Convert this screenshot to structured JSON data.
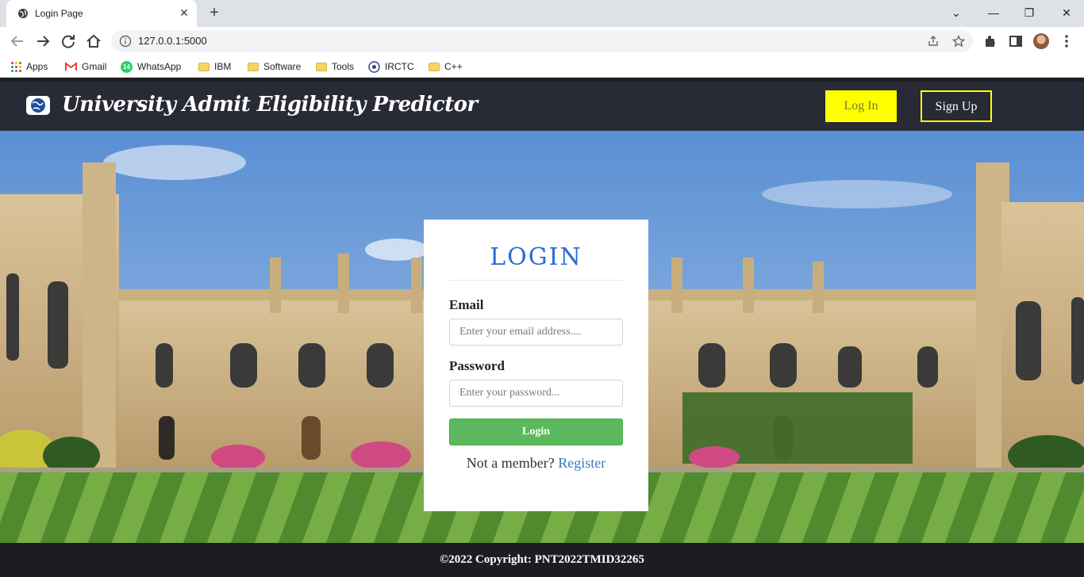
{
  "browser": {
    "tab_title": "Login Page",
    "url": "127.0.0.1:5000",
    "bookmarks": [
      {
        "label": "Apps",
        "icon": "apps-grid-icon"
      },
      {
        "label": "Gmail",
        "icon": "gmail-icon"
      },
      {
        "label": "WhatsApp",
        "icon": "whatsapp-icon",
        "badge": "14"
      },
      {
        "label": "IBM",
        "icon": "folder-icon"
      },
      {
        "label": "Software",
        "icon": "folder-icon"
      },
      {
        "label": "Tools",
        "icon": "folder-icon"
      },
      {
        "label": "IRCTC",
        "icon": "irctc-icon"
      },
      {
        "label": "C++",
        "icon": "folder-icon"
      }
    ]
  },
  "site": {
    "title": "University Admit Eligibility Predictor",
    "nav": {
      "login_label": "Log In",
      "signup_label": "Sign Up"
    },
    "accent_color": "#ffff00",
    "header_color": "#282a36"
  },
  "login_form": {
    "heading": "LOGIN",
    "email_label": "Email",
    "email_placeholder": "Enter your email address....",
    "password_label": "Password",
    "password_placeholder": "Enter your password...",
    "submit_label": "Login",
    "member_text": "Not a member?",
    "register_label": "Register"
  },
  "footer": {
    "copyright": "©2022 Copyright: PNT2022TMID32265"
  }
}
